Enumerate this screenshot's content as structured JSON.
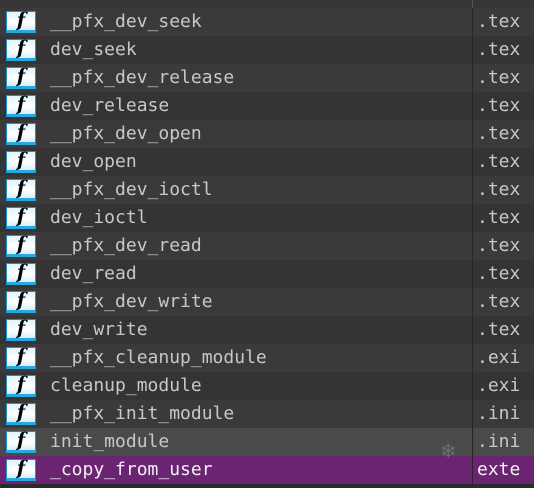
{
  "icon_glyph": "f",
  "icon_name": "function-icon",
  "colors": {
    "selected_row": "#6b2472",
    "hover_row": "#4a4a4a",
    "icon_border": "#29a7e0"
  },
  "functions": [
    {
      "name": "__pfx_dev_seek",
      "segment": ".tex"
    },
    {
      "name": "dev_seek",
      "segment": ".tex"
    },
    {
      "name": "__pfx_dev_release",
      "segment": ".tex"
    },
    {
      "name": "dev_release",
      "segment": ".tex"
    },
    {
      "name": "__pfx_dev_open",
      "segment": ".tex"
    },
    {
      "name": "dev_open",
      "segment": ".tex"
    },
    {
      "name": "__pfx_dev_ioctl",
      "segment": ".tex"
    },
    {
      "name": "dev_ioctl",
      "segment": ".tex"
    },
    {
      "name": "__pfx_dev_read",
      "segment": ".tex"
    },
    {
      "name": "dev_read",
      "segment": ".tex"
    },
    {
      "name": "__pfx_dev_write",
      "segment": ".tex"
    },
    {
      "name": "dev_write",
      "segment": ".tex"
    },
    {
      "name": "__pfx_cleanup_module",
      "segment": ".exi"
    },
    {
      "name": "cleanup_module",
      "segment": ".exi"
    },
    {
      "name": "__pfx_init_module",
      "segment": ".ini"
    },
    {
      "name": "init_module",
      "segment": ".ini",
      "state": "hover"
    },
    {
      "name": "_copy_from_user",
      "segment": "exte",
      "state": "selected"
    }
  ]
}
